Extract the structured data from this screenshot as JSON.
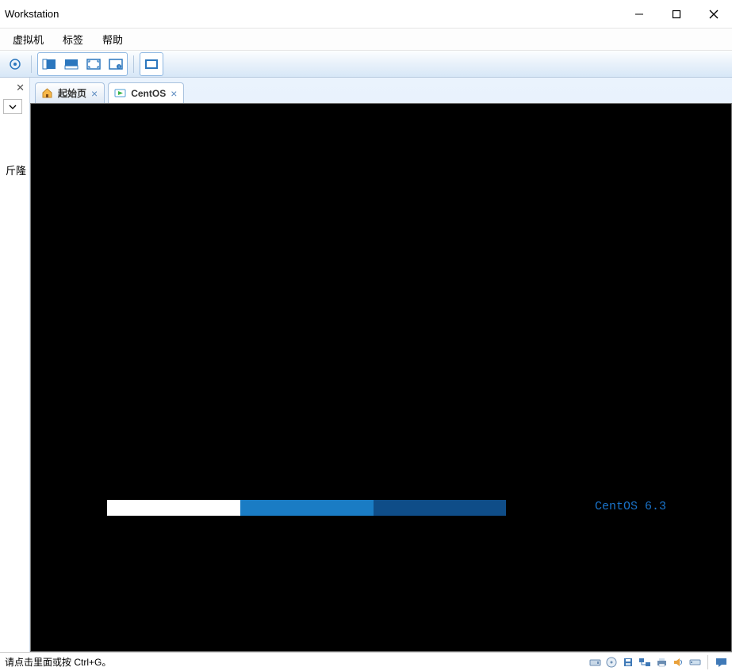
{
  "window": {
    "title": "Workstation",
    "title_partial_prefix": ""
  },
  "menu": {
    "items": [
      "虚拟机",
      "标签",
      "帮助"
    ]
  },
  "tabs": {
    "home_label": "起始页",
    "vm_label": "CentOS"
  },
  "sidebar": {
    "tree_text_fragment": "斤隆"
  },
  "vm": {
    "os_label": "CentOS 6.3"
  },
  "statusbar": {
    "hint": "请点击里面或按 Ctrl+G。"
  }
}
